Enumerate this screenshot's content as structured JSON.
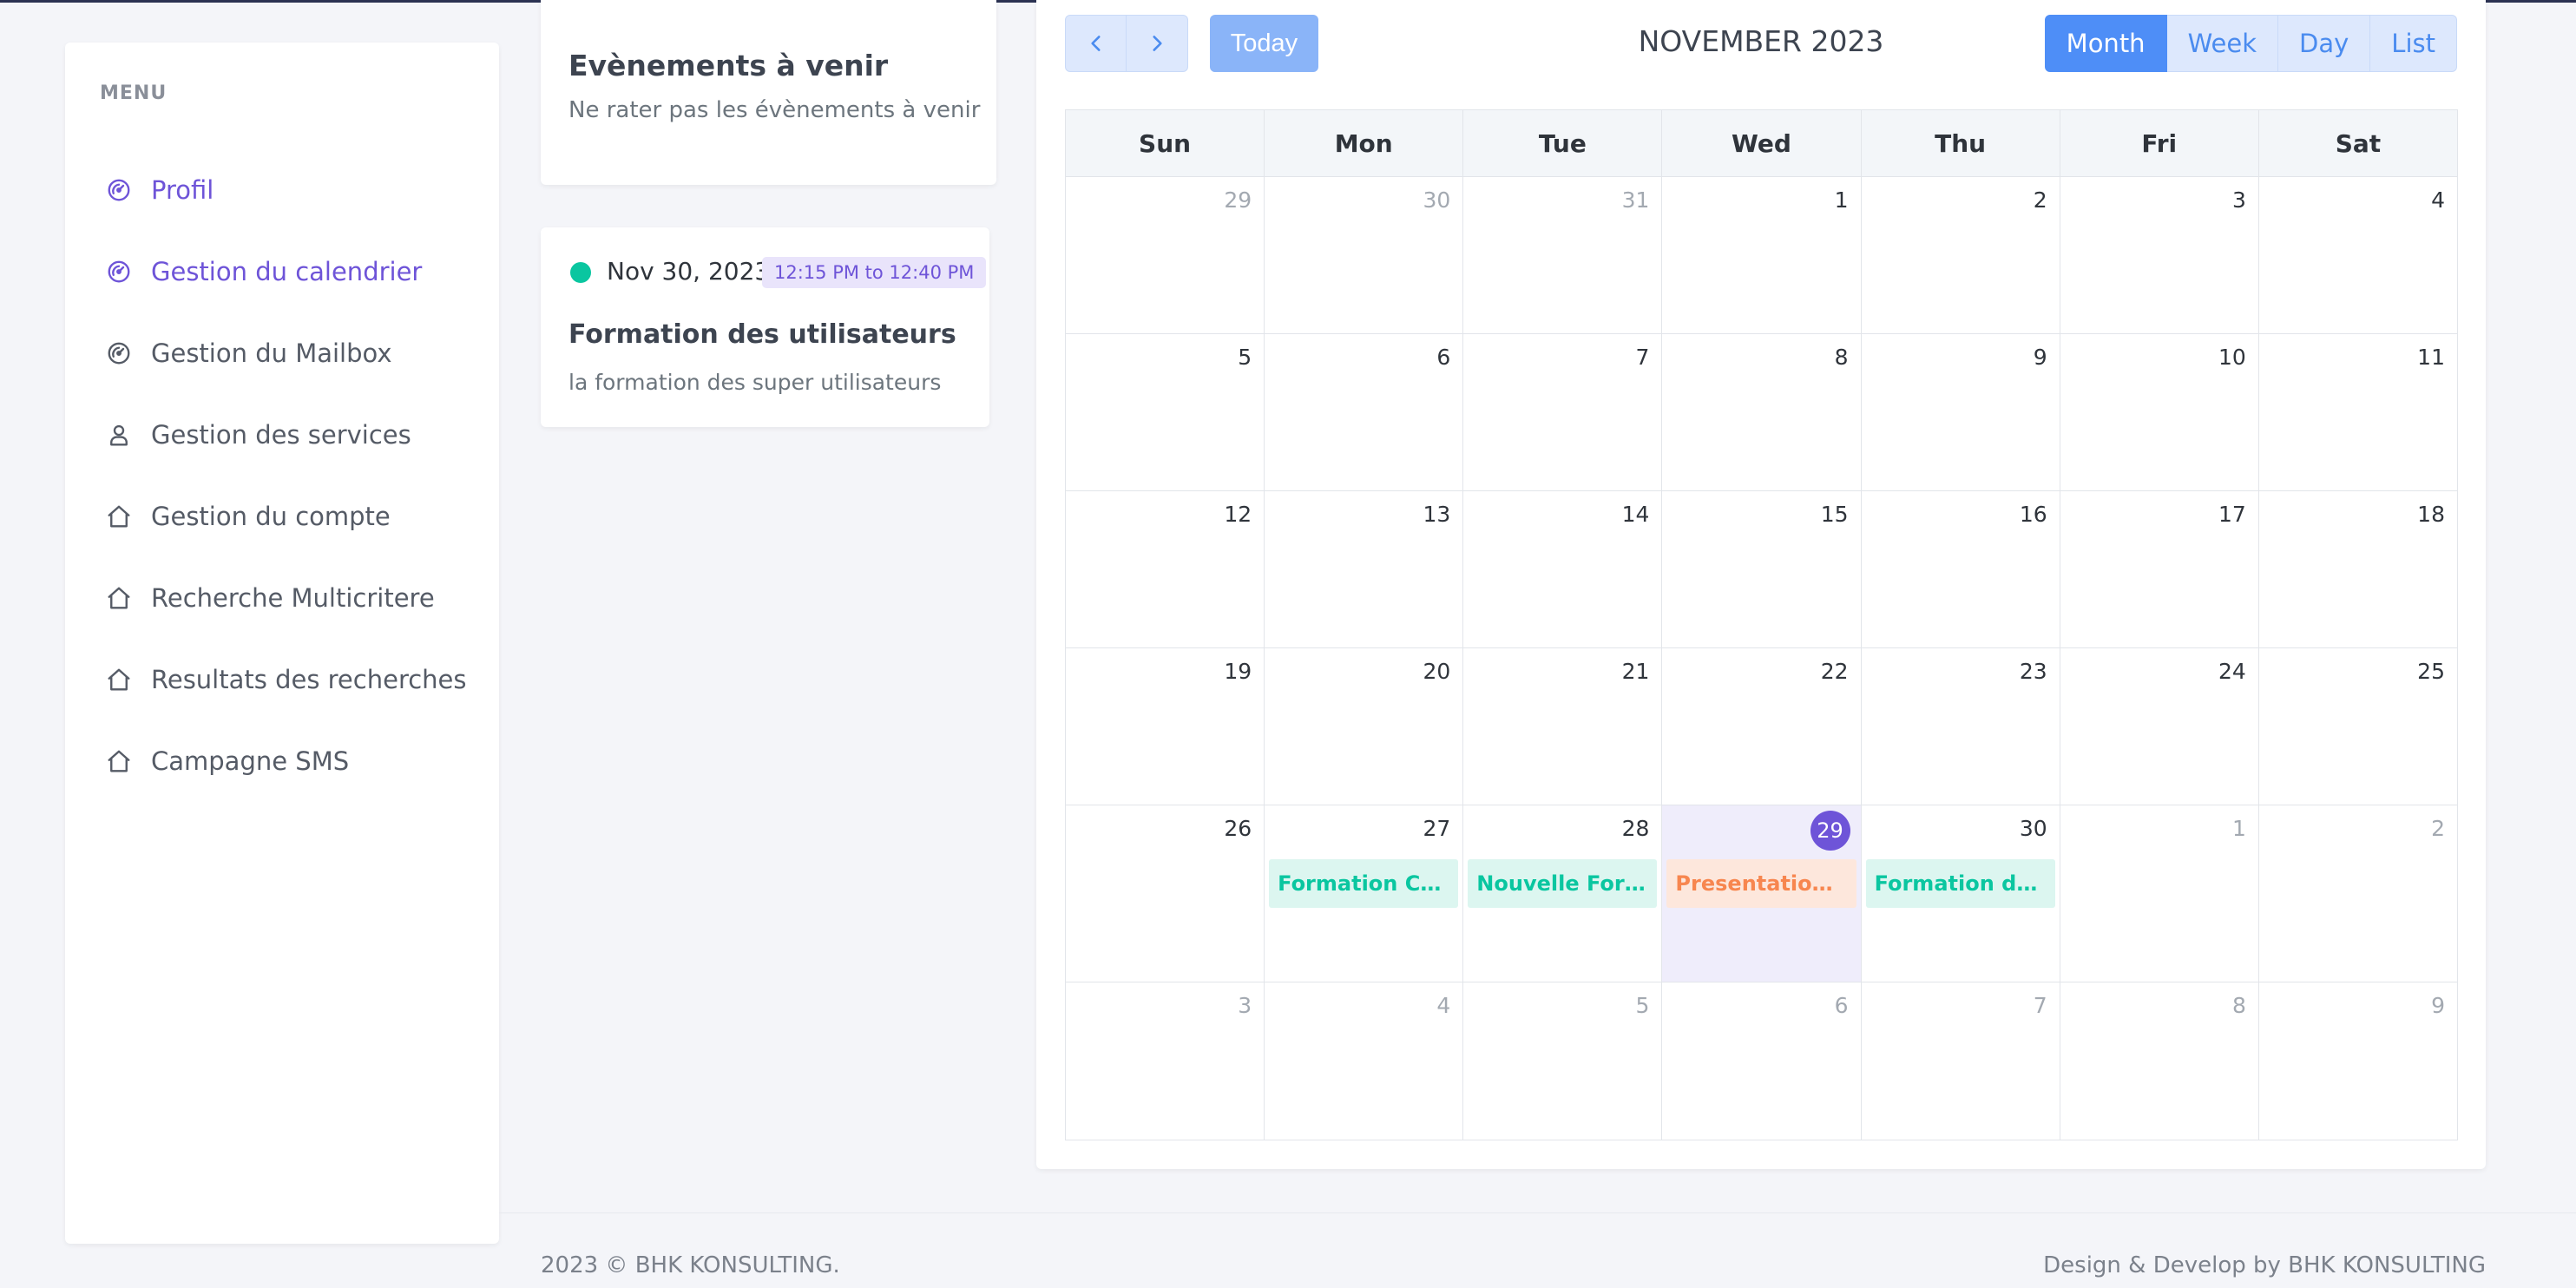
{
  "sidebar": {
    "menu_title": "MENU",
    "items": [
      {
        "label": "Profil",
        "icon": "dashboard-icon",
        "active": true
      },
      {
        "label": "Gestion du calendrier",
        "icon": "dashboard-icon",
        "active": true
      },
      {
        "label": "Gestion du Mailbox",
        "icon": "dashboard-icon",
        "active": false
      },
      {
        "label": "Gestion des services",
        "icon": "user-icon",
        "active": false
      },
      {
        "label": "Gestion du compte",
        "icon": "home-icon",
        "active": false
      },
      {
        "label": "Recherche Multicritere",
        "icon": "home-icon",
        "active": false
      },
      {
        "label": "Resultats des recherches",
        "icon": "home-icon",
        "active": false
      },
      {
        "label": "Campagne SMS",
        "icon": "home-icon",
        "active": false
      }
    ]
  },
  "upcoming": {
    "title": "Evènements à venir",
    "subtitle": "Ne rater pas les évènements à venir"
  },
  "upcoming_event": {
    "date": "Nov 30, 2023",
    "time": "12:15 PM to 12:40 PM",
    "title": "Formation des utilisateurs",
    "description": "la formation des super utilisateurs",
    "dot_color": "#0ac6a0"
  },
  "calendar": {
    "title": "NOVEMBER 2023",
    "today_label": "Today",
    "views": [
      "Month",
      "Week",
      "Day",
      "List"
    ],
    "active_view": "Month",
    "weekdays": [
      "Sun",
      "Mon",
      "Tue",
      "Wed",
      "Thu",
      "Fri",
      "Sat"
    ],
    "weeks": [
      [
        {
          "n": "29",
          "other": true
        },
        {
          "n": "30",
          "other": true
        },
        {
          "n": "31",
          "other": true
        },
        {
          "n": "1"
        },
        {
          "n": "2"
        },
        {
          "n": "3"
        },
        {
          "n": "4"
        }
      ],
      [
        {
          "n": "5"
        },
        {
          "n": "6"
        },
        {
          "n": "7"
        },
        {
          "n": "8"
        },
        {
          "n": "9"
        },
        {
          "n": "10"
        },
        {
          "n": "11"
        }
      ],
      [
        {
          "n": "12"
        },
        {
          "n": "13"
        },
        {
          "n": "14"
        },
        {
          "n": "15"
        },
        {
          "n": "16"
        },
        {
          "n": "17"
        },
        {
          "n": "18"
        }
      ],
      [
        {
          "n": "19"
        },
        {
          "n": "20"
        },
        {
          "n": "21"
        },
        {
          "n": "22"
        },
        {
          "n": "23"
        },
        {
          "n": "24"
        },
        {
          "n": "25"
        }
      ],
      [
        {
          "n": "26"
        },
        {
          "n": "27",
          "event": {
            "label": "Formation Cha...",
            "color": "#0ac6a0",
            "bg": "#dcf6f0"
          }
        },
        {
          "n": "28",
          "event": {
            "label": "Nouvelle Form...",
            "color": "#0ac6a0",
            "bg": "#dcf6f0"
          }
        },
        {
          "n": "29",
          "today": true,
          "event": {
            "label": "Presentation p...",
            "color": "#f7864f",
            "bg": "#fde7dc"
          }
        },
        {
          "n": "30",
          "event": {
            "label": "Formation des ...",
            "color": "#0ac6a0",
            "bg": "#dcf6f0"
          }
        },
        {
          "n": "1",
          "other": true
        },
        {
          "n": "2",
          "other": true
        }
      ],
      [
        {
          "n": "3",
          "other": true
        },
        {
          "n": "4",
          "other": true
        },
        {
          "n": "5",
          "other": true
        },
        {
          "n": "6",
          "other": true
        },
        {
          "n": "7",
          "other": true
        },
        {
          "n": "8",
          "other": true
        },
        {
          "n": "9",
          "other": true
        }
      ]
    ]
  },
  "footer": {
    "left": "2023 © BHK KONSULTING.",
    "right": "Design & Develop by BHK KONSULTING"
  },
  "colors": {
    "accent": "#6e54d8",
    "primary_button": "#4e8ef7",
    "event_teal": "#0ac6a0",
    "event_orange": "#f7864f"
  }
}
